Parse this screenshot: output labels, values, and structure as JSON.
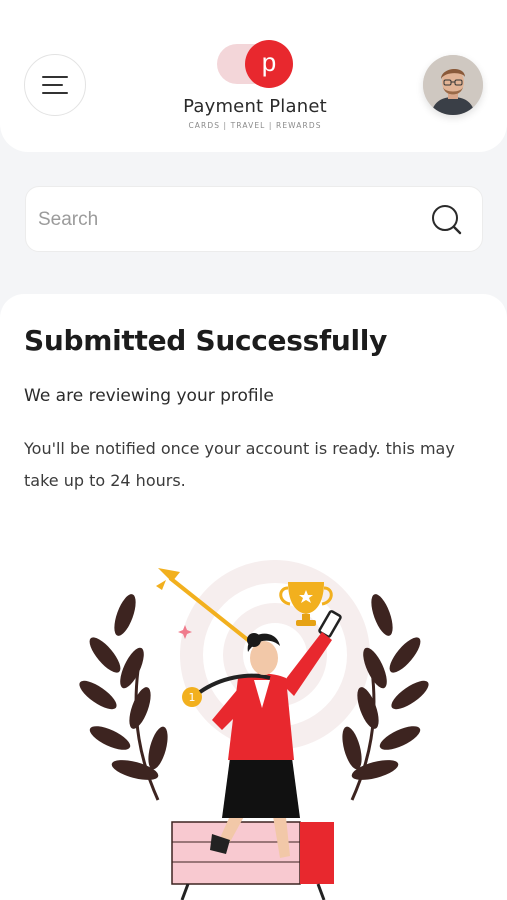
{
  "header": {
    "brand_name": "Payment Planet",
    "brand_tagline": "CARDS | TRAVEL | REWARDS",
    "logo_letter": "p",
    "menu_icon": "hamburger-menu-icon",
    "avatar": "user-avatar"
  },
  "search": {
    "placeholder": "Search",
    "value": "",
    "icon": "search-icon"
  },
  "status": {
    "title": "Submitted Successfully",
    "subtitle": "We are reviewing your profile",
    "description": "You'll be notified once your account is ready. this may take up to 24 hours."
  },
  "illustration": {
    "name": "success-celebration-illustration",
    "medal_text": "1"
  },
  "colors": {
    "brand_red": "#e8282e",
    "brand_pink": "#f3d6d9",
    "laurel": "#3d2420",
    "gold": "#f2b01e"
  }
}
